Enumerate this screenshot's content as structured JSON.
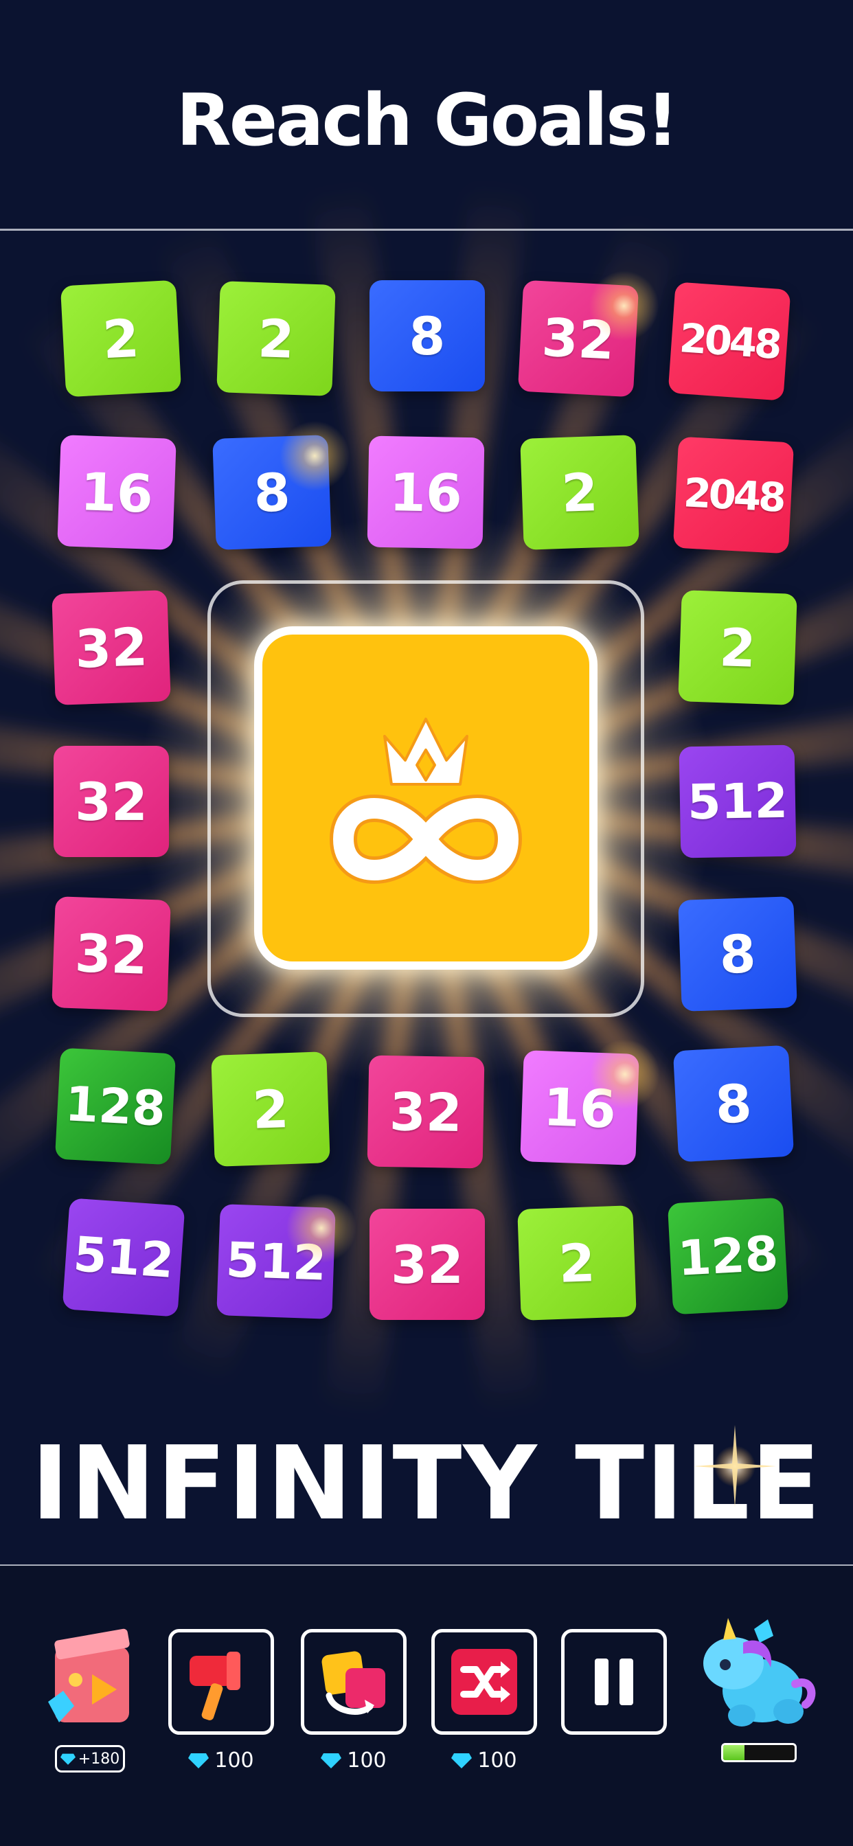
{
  "header": {
    "headline": "Reach Goals!"
  },
  "board": {
    "tiles": [
      {
        "label": "2",
        "color": "green"
      },
      {
        "label": "2",
        "color": "green"
      },
      {
        "label": "8",
        "color": "blue"
      },
      {
        "label": "32",
        "color": "pink"
      },
      {
        "label": "2048",
        "color": "red"
      },
      {
        "label": "16",
        "color": "magenta"
      },
      {
        "label": "8",
        "color": "blue"
      },
      {
        "label": "16",
        "color": "magenta"
      },
      {
        "label": "2",
        "color": "green"
      },
      {
        "label": "2048",
        "color": "red"
      },
      {
        "label": "32",
        "color": "pink"
      },
      {
        "label": "2",
        "color": "green"
      },
      {
        "label": "32",
        "color": "pink"
      },
      {
        "label": "512",
        "color": "purple"
      },
      {
        "label": "32",
        "color": "pink"
      },
      {
        "label": "8",
        "color": "blue"
      },
      {
        "label": "128",
        "color": "darkgreen"
      },
      {
        "label": "2",
        "color": "green"
      },
      {
        "label": "32",
        "color": "pink"
      },
      {
        "label": "16",
        "color": "magenta"
      },
      {
        "label": "8",
        "color": "blue"
      },
      {
        "label": "512",
        "color": "purple"
      },
      {
        "label": "512",
        "color": "purple"
      },
      {
        "label": "32",
        "color": "pink"
      },
      {
        "label": "2",
        "color": "green"
      },
      {
        "label": "128",
        "color": "darkgreen"
      }
    ],
    "center_icon": "crown-infinity-icon"
  },
  "game_title": "INFINITY TILE",
  "toolbar": {
    "ad_reward": "+180",
    "boosters": [
      {
        "name": "hammer",
        "icon": "hammer-icon",
        "cost": "100"
      },
      {
        "name": "swap",
        "icon": "swap-tiles-icon",
        "cost": "100"
      },
      {
        "name": "shuffle",
        "icon": "shuffle-icon",
        "cost": "100"
      }
    ],
    "pause_icon": "pause-icon",
    "pet_progress": 0.3
  },
  "colors": {
    "background": "#0b1330",
    "green": "#7ed61c",
    "blue": "#1a4df0",
    "pink": "#e0237c",
    "red": "#f01e4e",
    "magenta": "#d95af0",
    "purple": "#7a2ad6",
    "darkgreen": "#22a82a",
    "gold": "#ffc20e"
  }
}
